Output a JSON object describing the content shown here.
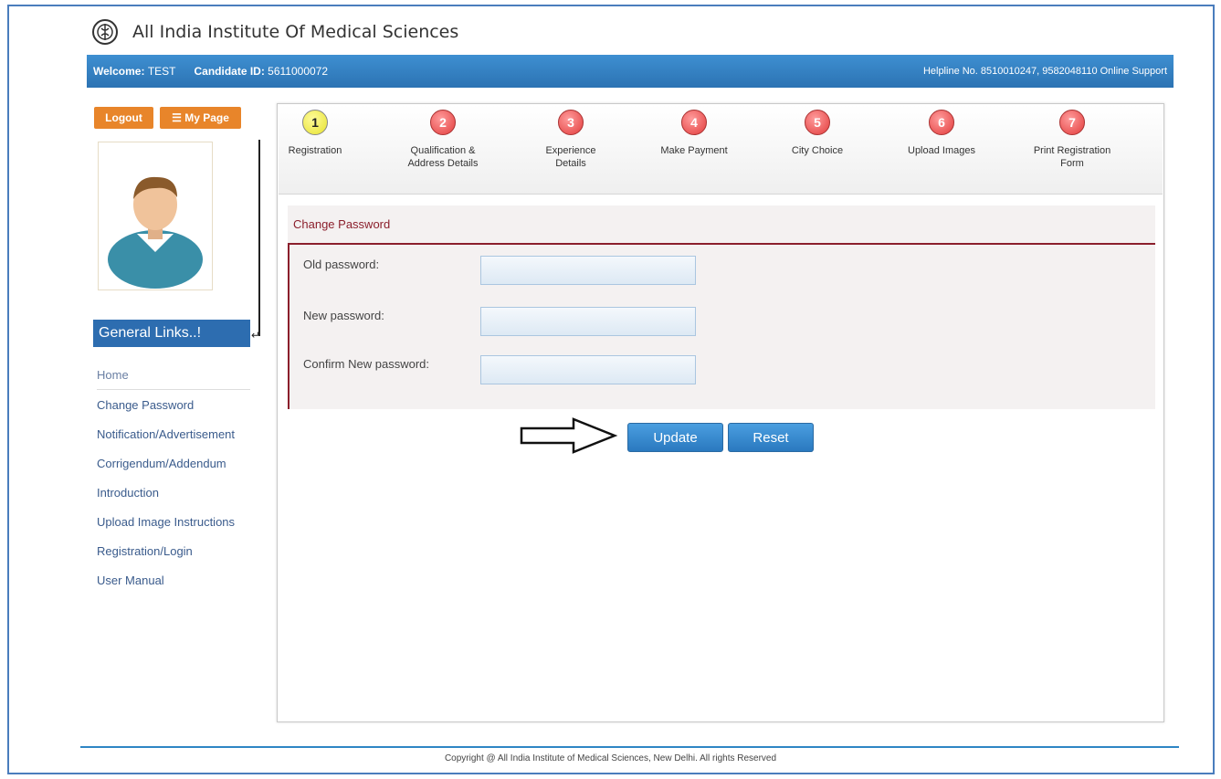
{
  "header": {
    "title": "All India Institute Of Medical Sciences",
    "logo_icon": "aiims-emblem-icon"
  },
  "topbar": {
    "welcome_label": "Welcome:",
    "welcome_value": "TEST",
    "candidate_label": "Candidate ID:",
    "candidate_value": "5611000072",
    "helpline": "Helpline No. 8510010247, 9582048110 Online Support"
  },
  "sidebar": {
    "logout_label": "Logout",
    "mypage_label": "☰ My Page",
    "general_links_title": "General Links..!",
    "links": [
      {
        "label": "Home"
      },
      {
        "label": "Change Password"
      },
      {
        "label": "Notification/Advertisement"
      },
      {
        "label": "Corrigendum/Addendum"
      },
      {
        "label": "Introduction"
      },
      {
        "label": "Upload Image Instructions"
      },
      {
        "label": "Registration/Login"
      },
      {
        "label": "User Manual"
      }
    ]
  },
  "steps": [
    {
      "num": "1",
      "label": "Registration",
      "status": "active"
    },
    {
      "num": "2",
      "label": "Qualification & Address Details",
      "status": "pending"
    },
    {
      "num": "3",
      "label": "Experience Details",
      "status": "pending"
    },
    {
      "num": "4",
      "label": "Make Payment",
      "status": "pending"
    },
    {
      "num": "5",
      "label": "City Choice",
      "status": "pending"
    },
    {
      "num": "6",
      "label": "Upload Images",
      "status": "pending"
    },
    {
      "num": "7",
      "label": "Print Registration Form",
      "status": "pending"
    }
  ],
  "form": {
    "title": "Change Password",
    "old_label": "Old password:",
    "old_value": "",
    "new_label": "New password:",
    "new_value": "",
    "confirm_label": "Confirm New password:",
    "confirm_value": "",
    "update_label": "Update",
    "reset_label": "Reset"
  },
  "footer": {
    "text": "Copyright @ All India Institute of Medical Sciences, New Delhi. All rights Reserved"
  },
  "colors": {
    "brand_blue": "#2c73b3",
    "accent_orange": "#e8852a",
    "form_border": "#8b1f2c",
    "step_active": "#e6e22f",
    "step_pending": "#e23c3c"
  }
}
